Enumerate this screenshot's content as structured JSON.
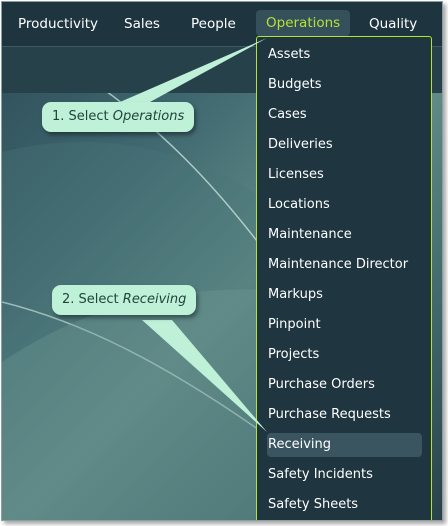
{
  "nav": {
    "items": [
      {
        "label": "Productivity"
      },
      {
        "label": "Sales"
      },
      {
        "label": "People"
      },
      {
        "label": "Operations",
        "active": true
      },
      {
        "label": "Quality"
      }
    ]
  },
  "dropdown": {
    "items": [
      "Assets",
      "Budgets",
      "Cases",
      "Deliveries",
      "Licenses",
      "Locations",
      "Maintenance",
      "Maintenance Director",
      "Markups",
      "Pinpoint",
      "Projects",
      "Purchase Orders",
      "Purchase Requests",
      "Receiving",
      "Safety Incidents",
      "Safety Sheets"
    ],
    "highlighted": "Receiving"
  },
  "callouts": {
    "step1": {
      "prefix": "1. Select ",
      "target": "Operations"
    },
    "step2": {
      "prefix": "2. Select ",
      "target": "Receiving"
    }
  },
  "colors": {
    "nav_bg": "#1e343f",
    "accent": "#b5e335",
    "callout_bg": "#bff0d8",
    "highlight_bg": "#3a5560"
  }
}
